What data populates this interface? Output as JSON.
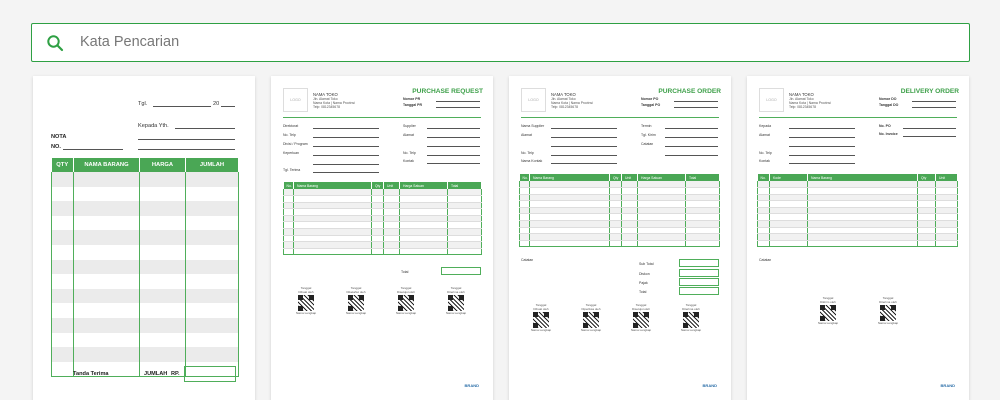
{
  "search": {
    "placeholder": "Kata Pencarian",
    "icon": "search-icon"
  },
  "nota": {
    "tgl_label": "Tgl.",
    "year_label": "20",
    "kepada_label": "Kepada Yth.",
    "nota_label": "NOTA",
    "no_label": "NO.",
    "columns": [
      "QTY",
      "NAMA BARANG",
      "HARGA",
      "JUMLAH"
    ],
    "tanda_terima": "Tanda Terima",
    "jumlah_label": "JUMLAH",
    "rp_label": "RP."
  },
  "pr": {
    "title": "PURCHASE REQUEST",
    "logo": "LOGO",
    "store_name": "NAMA TOKO",
    "store_addr1": "Jln. Alamat Toko",
    "store_addr2": "Nama Kota | Nama Provinsi",
    "store_phone": "Telp: 0812345678",
    "nomor": "Nomor PR",
    "tanggal": "Tanggal PR",
    "left_fields": [
      "Direktorat",
      "No. Telp",
      "Divisi / Program",
      "Keperluan",
      "Tgl. Terima"
    ],
    "right_fields": [
      "Supplier",
      "Alamat",
      "No. Telp",
      "Kontak"
    ],
    "columns": [
      "No.",
      "Nama Barang",
      "Qty",
      "Unit",
      "Harga Satuan",
      "Total"
    ],
    "total_label": "Total",
    "signatures": [
      "Dibuat oleh",
      "Diketahui oleh",
      "Disetujui oleh",
      "Diterima oleh"
    ],
    "sig_top": "Tanggal",
    "sig_bottom": "Nama Lengkap"
  },
  "po": {
    "title": "PURCHASE ORDER",
    "logo": "LOGO",
    "store_name": "NAMA TOKO",
    "store_addr1": "Jln. Alamat Toko",
    "store_addr2": "Nama Kota | Nama Provinsi",
    "store_phone": "Telp: 0812345678",
    "nomor": "Nomor PO",
    "tanggal": "Tanggal PO",
    "left_fields": [
      "Nama Supplier",
      "Alamat",
      "No. Telp",
      "Nama Kontak"
    ],
    "right_fields": [
      "Termin",
      "Tgl. Kirim",
      "Catatan"
    ],
    "columns": [
      "No.",
      "Nama Barang",
      "Qty",
      "Unit",
      "Harga Satuan",
      "Total"
    ],
    "catatan": "Catatan",
    "sum_labels": [
      "Sub Total",
      "Diskon",
      "Pajak",
      "Total"
    ],
    "signatures": [
      "Dibuat oleh",
      "Diperiksa oleh",
      "Disetujui oleh",
      "Diterima oleh"
    ],
    "sig_top": "Tanggal",
    "sig_bottom": "Nama Lengkap"
  },
  "do": {
    "title": "DELIVERY ORDER",
    "logo": "LOGO",
    "store_name": "NAMA TOKO",
    "store_addr1": "Jln. Alamat Toko",
    "store_addr2": "Nama Kota | Nama Provinsi",
    "store_phone": "Telp: 0812345678",
    "nomor": "Nomor DO",
    "tanggal": "Tanggal DO",
    "left_fields": [
      "Kepada",
      "Alamat",
      "No. Telp",
      "Kontak"
    ],
    "right_fields": [
      "No. PO",
      "No. Invoice"
    ],
    "columns": [
      "No.",
      "Kode",
      "Nama Barang",
      "Qty",
      "Unit"
    ],
    "catatan": "Catatan",
    "signatures": [
      "Dikirim oleh",
      "Diterima oleh"
    ],
    "sig_top": "Tanggal",
    "sig_bottom": "Nama Lengkap"
  },
  "brand": "BRAND",
  "colors": {
    "accent": "#3ea04a",
    "border": "#2ea043"
  }
}
